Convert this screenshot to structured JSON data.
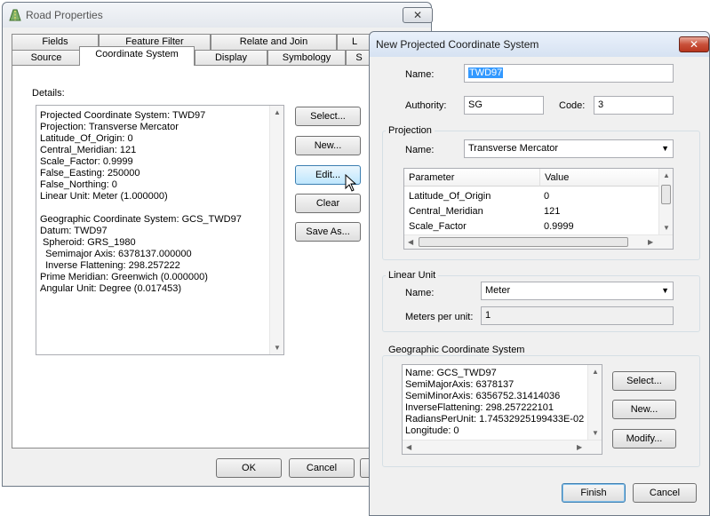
{
  "road_props": {
    "title": "Road  Properties",
    "tabs_back": [
      "Fields",
      "Feature Filter",
      "Relate and Join",
      "L"
    ],
    "tabs_front": [
      "Source",
      "Coordinate System",
      "Display",
      "Symbology",
      "S"
    ],
    "details_label": "Details:",
    "details_lines": [
      "Projected Coordinate System: TWD97",
      "Projection: Transverse Mercator",
      "Latitude_Of_Origin: 0",
      "Central_Meridian: 121",
      "Scale_Factor: 0.9999",
      "False_Easting: 250000",
      "False_Northing: 0",
      "Linear Unit: Meter (1.000000)",
      "",
      "Geographic Coordinate System: GCS_TWD97",
      "Datum: TWD97",
      " Spheroid: GRS_1980",
      "  Semimajor Axis: 6378137.000000",
      "  Inverse Flattening: 298.257222",
      "Prime Meridian: Greenwich (0.000000)",
      "Angular Unit: Degree (0.017453)"
    ],
    "buttons": {
      "select": "Select...",
      "new": "New...",
      "edit": "Edit...",
      "clear": "Clear",
      "save_as": "Save As...",
      "ok": "OK",
      "cancel": "Cancel"
    }
  },
  "new_pcs": {
    "title": "New Projected Coordinate System",
    "close": "✕",
    "name_label": "Name:",
    "name_value": "TWD97",
    "authority_label": "Authority:",
    "authority_value": "SG",
    "code_label": "Code:",
    "code_value": "3",
    "projection_group": "Projection",
    "projection_name_label": "Name:",
    "projection_value": "Transverse Mercator",
    "param_headers": [
      "Parameter",
      "Value"
    ],
    "params": [
      {
        "name": "Latitude_Of_Origin",
        "value": "0"
      },
      {
        "name": "Central_Meridian",
        "value": "121"
      },
      {
        "name": "Scale_Factor",
        "value": "0.9999"
      }
    ],
    "linear_group": "Linear Unit",
    "linear_name_label": "Name:",
    "linear_value": "Meter",
    "meters_label": "Meters per unit:",
    "meters_value": "1",
    "gcs_group": "Geographic Coordinate System",
    "gcs_lines": [
      "Name: GCS_TWD97",
      "SemiMajorAxis: 6378137",
      "SemiMinorAxis: 6356752.31414036",
      "InverseFlattening: 298.257222101",
      "RadiansPerUnit: 1.74532925199433E-02",
      "Longitude: 0"
    ],
    "buttons": {
      "select": "Select...",
      "new": "New...",
      "modify": "Modify...",
      "finish": "Finish",
      "cancel": "Cancel"
    }
  }
}
